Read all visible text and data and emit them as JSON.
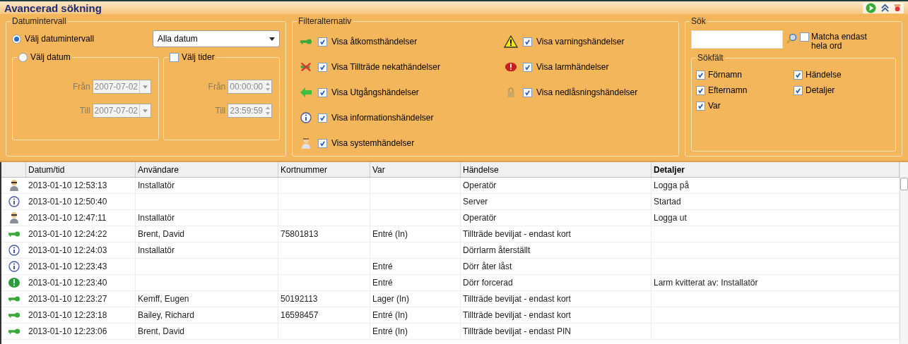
{
  "window": {
    "title": "Avancerad sökning"
  },
  "date_range": {
    "title": "Datumintervall",
    "range_option": {
      "label": "Välj datumintervall",
      "selected": true
    },
    "range_dropdown": {
      "value": "Alla datum"
    },
    "date_option": {
      "label": "Välj datum",
      "selected": false
    },
    "date_from": {
      "label": "Från",
      "value": "2007-07-02",
      "disabled": true
    },
    "date_to": {
      "label": "Till",
      "value": "2007-07-02",
      "disabled": true
    },
    "times": {
      "label": "Välj tider",
      "checked": false
    },
    "time_from": {
      "label": "Från",
      "value": "00:00:00",
      "disabled": true
    },
    "time_to": {
      "label": "Till",
      "value": "23:59:59",
      "disabled": true
    }
  },
  "filters": {
    "title": "Filteralternativ",
    "items": [
      {
        "kind": "key",
        "label": "Visa åtkomsthändelser",
        "checked": true
      },
      {
        "kind": "denied",
        "label": "Visa Tillträde nekathändelser",
        "checked": true
      },
      {
        "kind": "exit",
        "label": "Visa Utgångshändelser",
        "checked": true
      },
      {
        "kind": "info",
        "label": "Visa informationshändelser",
        "checked": true
      },
      {
        "kind": "system",
        "label": "Visa systemhändelser",
        "checked": true
      },
      {
        "kind": "warning",
        "label": "Visa varningshändelser",
        "checked": true
      },
      {
        "kind": "alarm",
        "label": "Visa larmhändelser",
        "checked": true
      },
      {
        "kind": "lock",
        "label": "Visa nedlåsningshändelser",
        "checked": true
      }
    ]
  },
  "search": {
    "title": "Sök",
    "whole_words": {
      "label": "Matcha endast hela ord",
      "checked": false
    },
    "fields_title": "Sökfält",
    "fields": [
      {
        "label": "Förnamn",
        "checked": true
      },
      {
        "label": "Händelse",
        "checked": true
      },
      {
        "label": "Efternamn",
        "checked": true
      },
      {
        "label": "Detaljer",
        "checked": true
      },
      {
        "label": "Var",
        "checked": true
      }
    ]
  },
  "table": {
    "columns": [
      "Datum/tid",
      "Användare",
      "Kortnummer",
      "Var",
      "Händelse",
      "Detaljer"
    ],
    "rows": [
      {
        "kind": "user",
        "cells": [
          "2013-01-10 12:53:13",
          "Installatör",
          "",
          "",
          "Operatör",
          "Logga på"
        ]
      },
      {
        "kind": "info",
        "cells": [
          "2013-01-10 12:50:40",
          "",
          "",
          "",
          "Server",
          "Startad"
        ]
      },
      {
        "kind": "user",
        "cells": [
          "2013-01-10 12:47:11",
          "Installatör",
          "",
          "",
          "Operatör",
          "Logga ut"
        ]
      },
      {
        "kind": "key",
        "cells": [
          "2013-01-10 12:24:22",
          "Brent, David",
          "75801813",
          "Entré (In)",
          "Tillträde beviljat - endast kort",
          ""
        ]
      },
      {
        "kind": "info",
        "cells": [
          "2013-01-10 12:24:03",
          "Installatör",
          "",
          "",
          "Dörrlarm återställt",
          ""
        ]
      },
      {
        "kind": "info",
        "cells": [
          "2013-01-10 12:23:43",
          "",
          "",
          "Entré",
          "Dörr åter låst",
          ""
        ]
      },
      {
        "kind": "alarm_ack",
        "cells": [
          "2013-01-10 12:23:40",
          "",
          "",
          "Entré",
          "Dörr forcerad",
          "Larm kvitterat av: Installatör"
        ]
      },
      {
        "kind": "key",
        "cells": [
          "2013-01-10 12:23:27",
          "Kemff, Eugen",
          "50192113",
          "Lager (In)",
          "Tillträde beviljat - endast kort",
          ""
        ]
      },
      {
        "kind": "key",
        "cells": [
          "2013-01-10 12:23:18",
          "Bailey, Richard",
          "16598457",
          "Entré (In)",
          "Tillträde beviljat - endast kort",
          ""
        ]
      },
      {
        "kind": "key",
        "cells": [
          "2013-01-10 12:23:06",
          "Brent, David",
          "",
          "Entré (In)",
          "Tillträde beviljat - endast PIN",
          ""
        ]
      }
    ]
  }
}
